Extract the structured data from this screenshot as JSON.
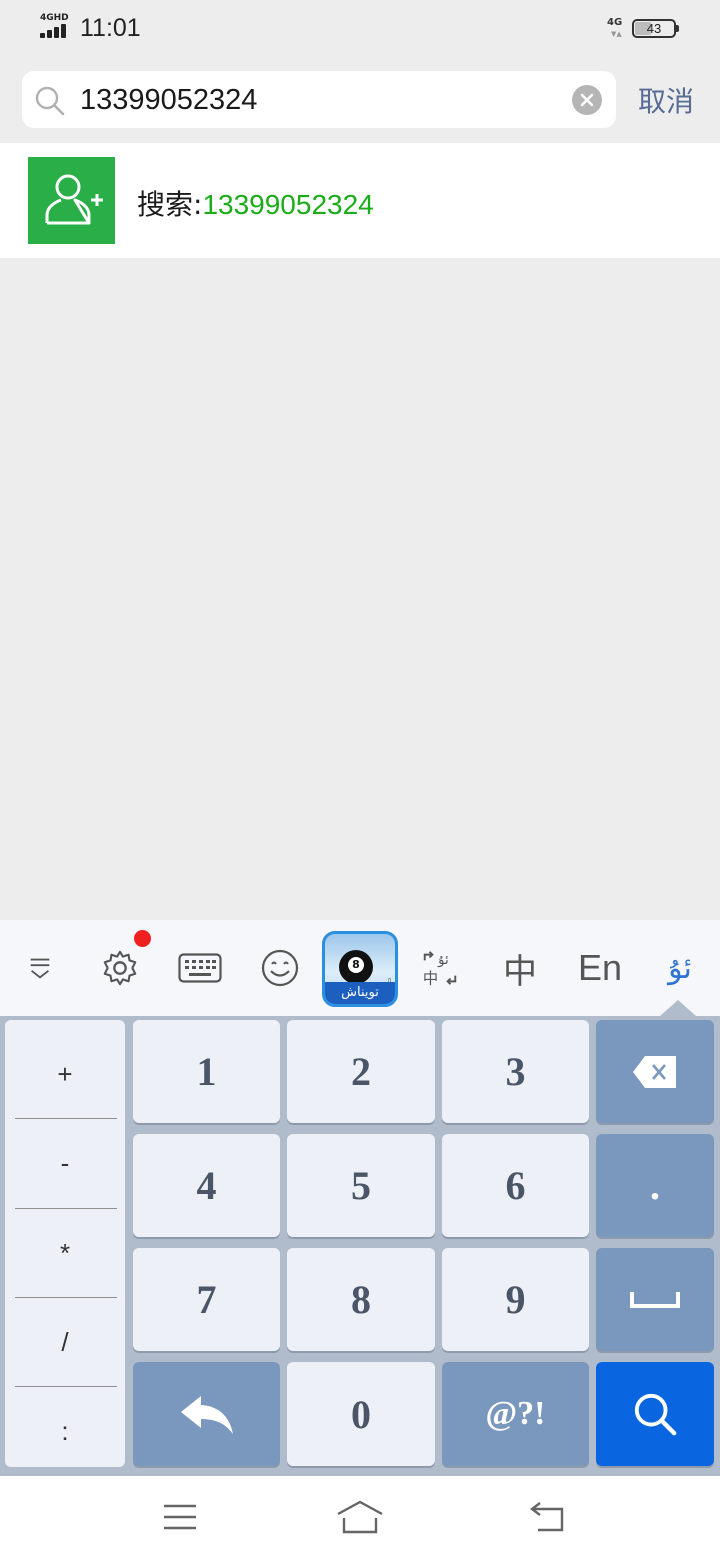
{
  "status_bar": {
    "network_label": "4GHD",
    "time": "11:01",
    "network_right": "4G",
    "battery_percent": 43,
    "battery_label": "43"
  },
  "search": {
    "query": "13399052324",
    "cancel_label": "取消"
  },
  "result": {
    "prefix": "搜索:",
    "query": "13399052324",
    "icon": "add-contact-icon"
  },
  "keyboard": {
    "toolbar": {
      "chinese_label": "中",
      "english_label": "En",
      "uyghur_label": "ئۇ",
      "ad_app_label": "تويناش",
      "ad_ball_number": "8"
    },
    "side_keys": [
      "+",
      "-",
      "*",
      "/",
      ":"
    ],
    "keys": {
      "k1": "1",
      "k2": "2",
      "k3": "3",
      "k4": "4",
      "k5": "5",
      "k6": "6",
      "k7": "7",
      "k8": "8",
      "k9": "9",
      "k0": "0",
      "dot": ".",
      "symbols": "@?!"
    }
  },
  "colors": {
    "accent_green": "#1aad19",
    "link_blue": "#576b95",
    "search_key_blue": "#0a66e0"
  }
}
